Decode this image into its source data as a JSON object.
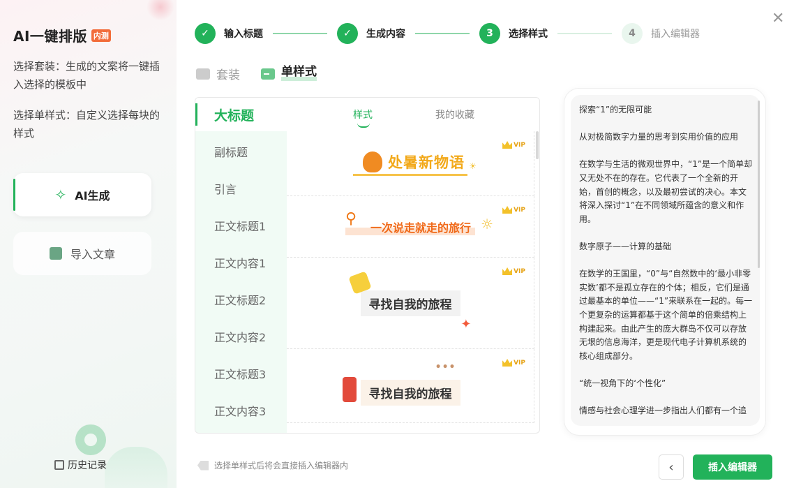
{
  "app": {
    "name": "AI一键排版",
    "tag": "内测"
  },
  "left": {
    "desc1": "选择套装：生成的文案将一键插入选择的模板中",
    "desc2": "选择单样式：自定义选择每块的样式",
    "ai_button": "AI生成",
    "import_button": "导入文章",
    "history": "历史记录"
  },
  "steps": [
    {
      "num": "1",
      "label": "输入标题",
      "done": true
    },
    {
      "num": "2",
      "label": "生成内容",
      "done": true
    },
    {
      "num": "3",
      "label": "选择样式",
      "done": false
    },
    {
      "num": "4",
      "label": "插入编辑器",
      "done": false
    }
  ],
  "mode_tabs": {
    "suite": "套装",
    "single": "单样式"
  },
  "categories": [
    "大标题",
    "副标题",
    "引言",
    "正文标题1",
    "正文内容1",
    "正文标题2",
    "正文内容2",
    "正文标题3",
    "正文内容3"
  ],
  "sub_tabs": {
    "style": "样式",
    "favorites": "我的收藏"
  },
  "cards": {
    "vip": "VIP",
    "c1": "处暑新物语",
    "c2": "一次说走就走的旅行",
    "c3": "寻找自我的旅程",
    "c4": "寻找自我的旅程"
  },
  "preview": [
    "探索“1”的无限可能",
    "从对极简数字力量的思考到实用价值的应用",
    "在数学与生活的微观世界中，“1”是一个简单却又无处不在的存在。它代表了一个全新的开始，首创的概念，以及最初尝试的决心。本文将深入探讨“1”在不同领域所蕴含的意义和作用。",
    "数字原子——计算的基础",
    "在数学的王国里，“0”与“自然数中的‘最小非零实数’都不是孤立存在的个体；相反，它们是通过最基本的单位——“1”来联系在一起的。每一个更复杂的运算都基于这个简单的倍乘结构上构建起来。由此产生的庞大群岛不仅可以存放无垠的信息海洋，更是现代电子计算机系统的核心组成部分。",
    "“统一视角下的‘个性化”",
    "情感与社会心理学进一步指出人们都有一个追"
  ],
  "footer": {
    "hint": "选择单样式后将会直接插入编辑器内",
    "back": "‹",
    "insert": "插入编辑器"
  },
  "colors": {
    "accent": "#22b25a",
    "vip": "#f3c12a"
  }
}
